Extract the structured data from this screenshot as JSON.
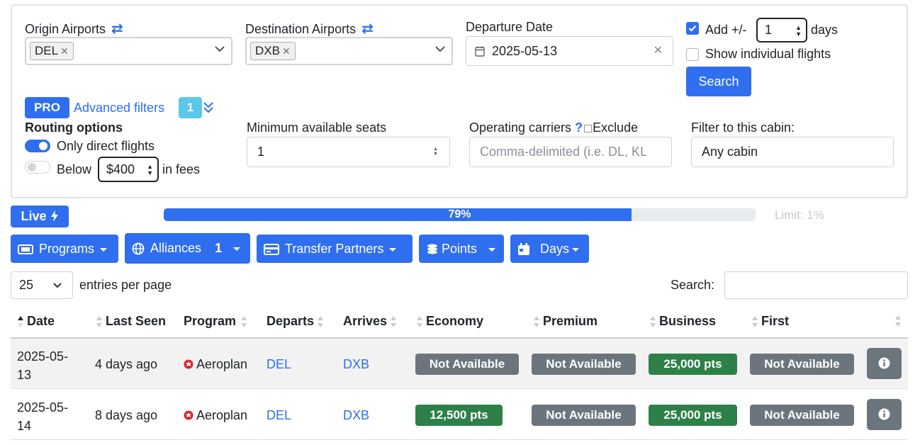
{
  "search": {
    "origin_label": "Origin Airports",
    "origin_chip": "DEL",
    "destination_label": "Destination Airports",
    "destination_chip": "DXB",
    "departure_label": "Departure Date",
    "departure_value": "2025-05-13",
    "add_days_label": "Add +/-",
    "add_days_value": "1",
    "days_label": "days",
    "show_individual_label": "Show individual flights",
    "search_button": "Search"
  },
  "filters": {
    "pro_badge": "PRO",
    "advanced_label": "Advanced filters",
    "advanced_count": "1",
    "routing_title": "Routing options",
    "direct_label": "Only direct flights",
    "below_label": "Below",
    "fee_value": "$400",
    "fees_label": "in fees",
    "min_seats_label": "Minimum available seats",
    "min_seats_value": "1",
    "carriers_label": "Operating carriers",
    "carriers_help": "?",
    "exclude_label": "Exclude",
    "carriers_placeholder": "Comma-delimited (i.e. DL, KL",
    "cabin_label": "Filter to this cabin:",
    "cabin_value": "Any cabin"
  },
  "status": {
    "live_label": "Live",
    "progress_text": "79%",
    "progress_value": 0.79,
    "limit_text": "Limit: 1%"
  },
  "toolbar": {
    "programs": "Programs",
    "alliances": "Alliances",
    "alliances_count": "1",
    "transfer": "Transfer Partners",
    "points": "Points",
    "days": "Days"
  },
  "table_controls": {
    "entries_value": "25",
    "entries_label": "entries per page",
    "search_label": "Search:"
  },
  "table": {
    "headers": [
      "Date",
      "Last Seen",
      "Program",
      "Departs",
      "Arrives",
      "Economy",
      "Premium",
      "Business",
      "First"
    ],
    "rows": [
      {
        "date_a": "2025-05-",
        "date_b": "13",
        "last_seen": "4 days ago",
        "program": "Aeroplan",
        "departs": "DEL",
        "arrives": "DXB",
        "economy": "Not Available",
        "premium": "Not Available",
        "business": "25,000 pts",
        "first": "Not Available"
      },
      {
        "date_a": "2025-05-",
        "date_b": "14",
        "last_seen": "8 days ago",
        "program": "Aeroplan",
        "departs": "DEL",
        "arrives": "DXB",
        "economy": "12,500 pts",
        "premium": "Not Available",
        "business": "25,000 pts",
        "first": "Not Available"
      }
    ]
  },
  "colors": {
    "primary": "#2f6fef",
    "available": "#2e8049",
    "unavailable": "#6c757d",
    "info": "#5bc8e8"
  }
}
